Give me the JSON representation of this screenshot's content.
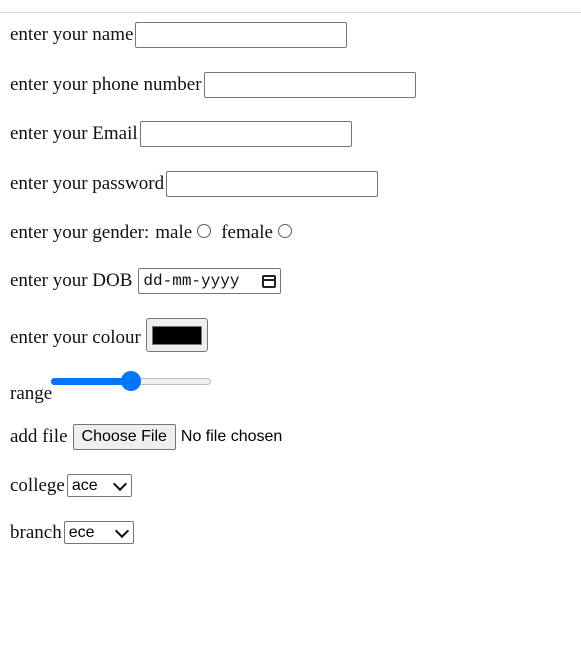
{
  "form": {
    "name": {
      "label": "enter your name",
      "value": ""
    },
    "phone": {
      "label": "enter your phone number",
      "value": ""
    },
    "email": {
      "label": "enter your Email",
      "value": ""
    },
    "password": {
      "label": "enter your password",
      "value": ""
    },
    "gender": {
      "label": "enter your gender:",
      "options": [
        {
          "label": "male",
          "selected": false
        },
        {
          "label": "female",
          "selected": false
        }
      ]
    },
    "dob": {
      "label": "enter your DOB",
      "placeholder": "dd-mm-yyyy",
      "icon": "calendar-icon"
    },
    "colour": {
      "label": "enter your colour",
      "value": "#000000"
    },
    "range": {
      "label": "range",
      "value_fraction": 0.5,
      "accent_color": "#0075ff"
    },
    "file": {
      "label": "add file",
      "button_label": "Choose File",
      "status": "No file chosen"
    },
    "college": {
      "label": "college",
      "selected": "ace",
      "icon": "chevron-down-icon"
    },
    "branch": {
      "label": "branch",
      "selected": "ece",
      "icon": "chevron-down-icon"
    }
  }
}
